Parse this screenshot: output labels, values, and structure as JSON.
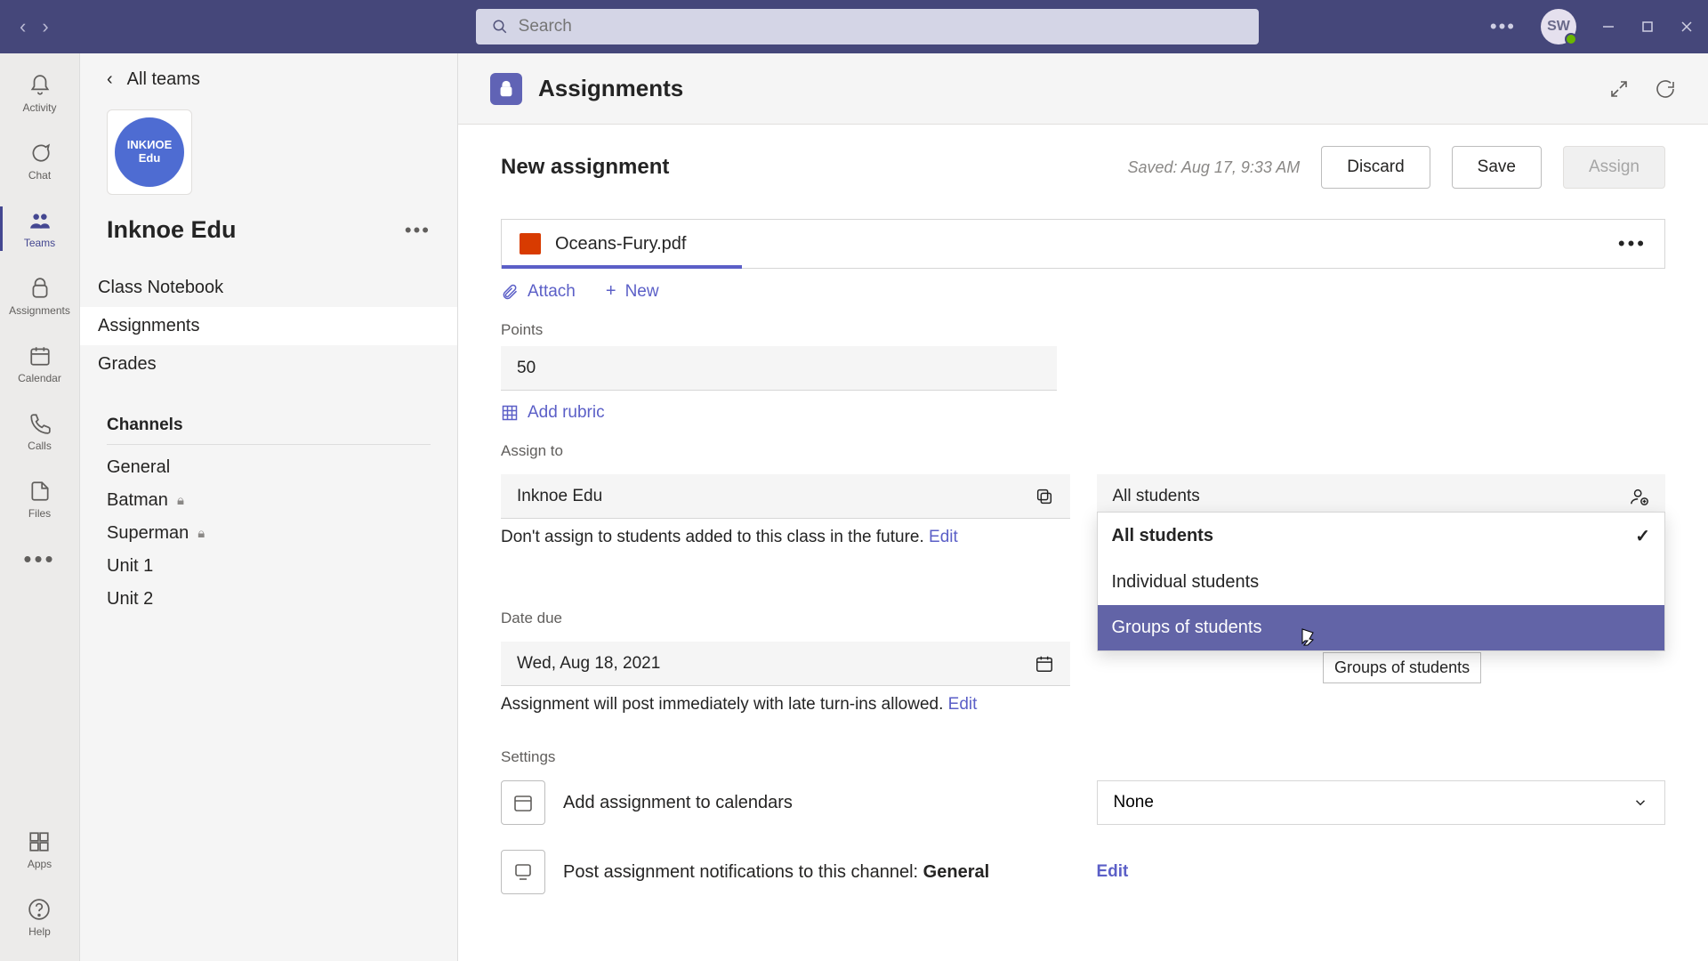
{
  "titlebar": {
    "search_placeholder": "Search",
    "avatar_initials": "SW"
  },
  "rail": {
    "items": [
      {
        "label": "Activity"
      },
      {
        "label": "Chat"
      },
      {
        "label": "Teams"
      },
      {
        "label": "Assignments"
      },
      {
        "label": "Calendar"
      },
      {
        "label": "Calls"
      },
      {
        "label": "Files"
      }
    ],
    "apps_label": "Apps",
    "help_label": "Help"
  },
  "teampanel": {
    "back_label": "All teams",
    "team_chip_line1": "INKИOE",
    "team_chip_line2": "Edu",
    "team_name": "Inknoe Edu",
    "nav": [
      {
        "label": "Class Notebook"
      },
      {
        "label": "Assignments"
      },
      {
        "label": "Grades"
      }
    ],
    "channels_header": "Channels",
    "channels": [
      {
        "label": "General",
        "locked": false
      },
      {
        "label": "Batman",
        "locked": true
      },
      {
        "label": "Superman",
        "locked": true
      },
      {
        "label": "Unit 1",
        "locked": false
      },
      {
        "label": "Unit 2",
        "locked": false
      }
    ]
  },
  "header": {
    "app_title": "Assignments"
  },
  "assignment": {
    "title": "New assignment",
    "saved_text": "Saved: Aug 17, 9:33 AM",
    "discard_label": "Discard",
    "save_label": "Save",
    "assign_label": "Assign",
    "attachment_name": "Oceans-Fury.pdf",
    "attach_label": "Attach",
    "new_label": "New",
    "points_label": "Points",
    "points_value": "50",
    "add_rubric_label": "Add rubric",
    "assign_to_label": "Assign to",
    "class_value": "Inknoe Edu",
    "assignee_value": "All students",
    "dropdown": {
      "all": "All students",
      "individual": "Individual students",
      "groups": "Groups of students"
    },
    "tooltip_text": "Groups of students",
    "future_text": "Don't assign to students added to this class in the future. ",
    "edit_label": "Edit",
    "date_due_label": "Date due",
    "date_value": "Wed, Aug 18, 2021",
    "post_text": "Assignment will post immediately with late turn-ins allowed. ",
    "settings_label": "Settings",
    "calendar_text": "Add assignment to calendars",
    "calendar_select": "None",
    "notify_prefix": "Post assignment notifications to this channel: ",
    "notify_channel": "General"
  }
}
